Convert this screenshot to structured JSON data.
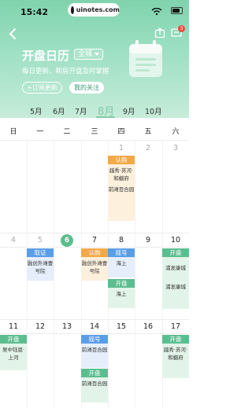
{
  "status": {
    "time": "15:42",
    "site": "uinotes.com"
  },
  "header": {
    "title": "开盘日历",
    "city": "全城",
    "subtitle": "每日更新，新房开盘及时掌握",
    "subscribe_button": "+订阅更新",
    "my_follow_button": "我的关注",
    "badge_count": "3"
  },
  "months": [
    "5月",
    "6月",
    "7月",
    "8月",
    "9月",
    "10月"
  ],
  "active_month": "8月",
  "weekdays": [
    "日",
    "一",
    "二",
    "三",
    "四",
    "五",
    "六"
  ],
  "weeks": [
    {
      "days": [
        "",
        "",
        "",
        "",
        "1",
        "2",
        "3"
      ]
    },
    {
      "days": [
        "4",
        "5",
        "6",
        "7",
        "8",
        "9",
        "10"
      ]
    },
    {
      "days": [
        "11",
        "12",
        "13",
        "14",
        "15",
        "16",
        "17"
      ]
    }
  ],
  "today": "6",
  "events": {
    "w1_thu": {
      "tag": "认购",
      "items": [
        "越秀·苏河·和樾府",
        "前滩百合园"
      ]
    },
    "w2_mon": {
      "tag": "取证",
      "items": [
        "融创外滩壹号院"
      ]
    },
    "w2_wed": {
      "tag": "认购",
      "items": [
        "融创外滩壹号院"
      ]
    },
    "w2_thu_a": {
      "tag": "摇号",
      "items": [
        "海上"
      ]
    },
    "w2_thu_b": {
      "tag": "开盘",
      "items": [
        "海上"
      ]
    },
    "w2_sat": {
      "tag": "开盘",
      "items": [
        "浦发康城",
        "浦发康城"
      ]
    },
    "w3_sun": {
      "tag": "开盘",
      "items": [
        "吴中钰恩·上河"
      ]
    },
    "w3_wed_a": {
      "tag": "摇号",
      "items": [
        "前滩百合园"
      ]
    },
    "w3_wed_b": {
      "tag": "开盘",
      "items": [
        "前滩百合园"
      ]
    },
    "w3_sat": {
      "tag": "开盘",
      "items": [
        "越秀·苏河·和樾府"
      ]
    }
  },
  "colors": {
    "accent": "#5cbd8e",
    "orange": "#f4a948",
    "blue": "#5a9ee8",
    "badge": "#e84a3c"
  }
}
